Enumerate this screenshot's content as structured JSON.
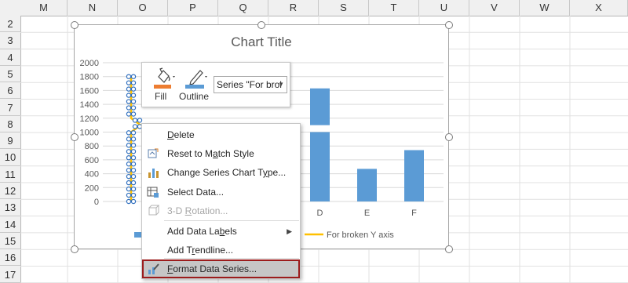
{
  "spreadsheet": {
    "columns": [
      "M",
      "N",
      "O",
      "P",
      "Q",
      "R",
      "S",
      "T",
      "U",
      "V",
      "W",
      "X"
    ],
    "rows": [
      "2",
      "3",
      "4",
      "5",
      "6",
      "7",
      "8",
      "9",
      "10",
      "11",
      "12",
      "13",
      "14",
      "15",
      "16",
      "17"
    ]
  },
  "chart": {
    "title": "Chart Title",
    "legend_label": "For broken Y axis",
    "colors": {
      "bars": "#5b9bd5",
      "line": "#ffc000",
      "selection": "#2f6fbf"
    }
  },
  "chart_data": {
    "type": "bar",
    "title": "Chart Title",
    "ylim": [
      0,
      2000
    ],
    "yticks": [
      "2000",
      "1800",
      "1600",
      "1400",
      "1200",
      "1000",
      "800",
      "600",
      "400",
      "200",
      "0"
    ],
    "categories": [
      "D",
      "E",
      "F"
    ],
    "series": [
      {
        "name": "",
        "values": [
          1630,
          470,
          740
        ],
        "break_gap": [
          1000,
          1100
        ]
      },
      {
        "name": "For broken Y axis",
        "values": []
      }
    ],
    "legend": "bottom",
    "grid": true
  },
  "mini_toolbar": {
    "fill_label": "Fill",
    "outline_label": "Outline",
    "series_selector": "Series \"For brol"
  },
  "context_menu": {
    "items": [
      {
        "label_pre": "",
        "label_key": "D",
        "label_post": "elete",
        "icon": "none-icon",
        "disabled": false
      },
      {
        "label_pre": "Reset to M",
        "label_key": "a",
        "label_post": "tch Style",
        "icon": "reset-style-icon",
        "disabled": false
      },
      {
        "label_pre": "Change Series Chart T",
        "label_key": "y",
        "label_post": "pe...",
        "icon": "chart-type-icon",
        "disabled": false
      },
      {
        "label_pre": "Select Data...",
        "label_key": "",
        "label_post": "",
        "icon": "select-data-icon",
        "disabled": false
      },
      {
        "label_pre": "3-D ",
        "label_key": "R",
        "label_post": "otation...",
        "icon": "rotation-icon",
        "disabled": true
      },
      {
        "label_pre": "Add Data La",
        "label_key": "b",
        "label_post": "els",
        "icon": "none-icon",
        "disabled": false,
        "submenu": true
      },
      {
        "label_pre": "Add T",
        "label_key": "r",
        "label_post": "endline...",
        "icon": "none-icon",
        "disabled": false
      },
      {
        "label_pre": "",
        "label_key": "F",
        "label_post": "ormat Data Series...",
        "icon": "format-series-icon",
        "disabled": false
      }
    ]
  }
}
